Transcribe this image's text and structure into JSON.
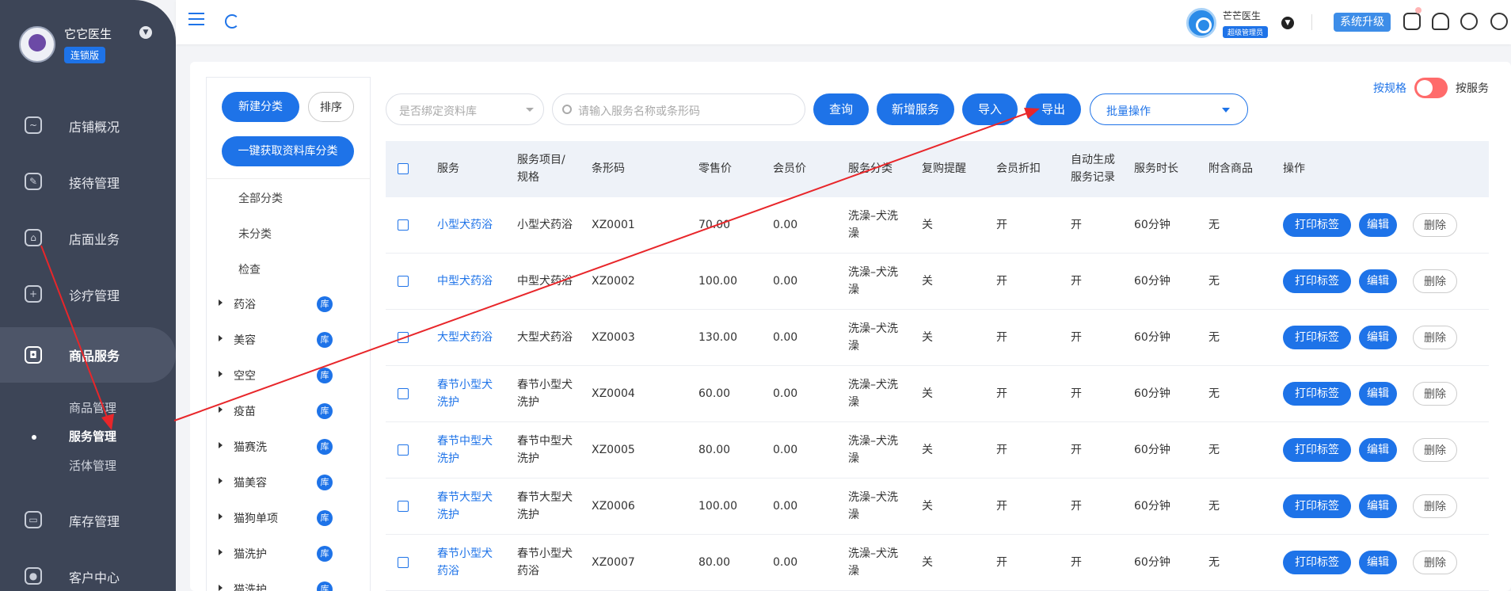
{
  "sidebar": {
    "user_name": "它它医生",
    "badge": "连锁版",
    "nav": [
      {
        "label": "店铺概况"
      },
      {
        "label": "接待管理"
      },
      {
        "label": "店面业务"
      },
      {
        "label": "诊疗管理"
      },
      {
        "label": "商品服务"
      },
      {
        "label": "库存管理"
      },
      {
        "label": "客户中心"
      }
    ],
    "sub_items": [
      {
        "label": "商品管理"
      },
      {
        "label": "服务管理"
      },
      {
        "label": "活体管理"
      }
    ]
  },
  "topbar": {
    "user_name": "芒芒医生",
    "role": "超级管理员",
    "upgrade_label": "系统升级"
  },
  "categories": {
    "new_btn": "新建分类",
    "sort_btn": "排序",
    "fetch_btn": "一键获取资料库分类",
    "static_items": [
      "全部分类",
      "未分类",
      "检查"
    ],
    "tree": [
      {
        "label": "药浴",
        "tag": "库"
      },
      {
        "label": "美容",
        "tag": "库"
      },
      {
        "label": "空空",
        "tag": "库"
      },
      {
        "label": "疫苗",
        "tag": "库"
      },
      {
        "label": "猫赛洗",
        "tag": "库"
      },
      {
        "label": "猫美容",
        "tag": "库"
      },
      {
        "label": "猫狗单项",
        "tag": "库"
      },
      {
        "label": "猫洗护",
        "tag": "库"
      },
      {
        "label": "猫洗护",
        "tag": "库"
      }
    ]
  },
  "filters": {
    "library_placeholder": "是否绑定资料库",
    "search_placeholder": "请输入服务名称或条形码",
    "query_btn": "查询",
    "add_btn": "新增服务",
    "import_btn": "导入",
    "export_btn": "导出",
    "batch_label": "批量操作",
    "toggle_left": "按规格",
    "toggle_right": "按服务"
  },
  "table": {
    "headers": {
      "service": "服务",
      "spec_1": "服务项目/",
      "spec_2": "规格",
      "barcode": "条形码",
      "retail": "零售价",
      "member": "会员价",
      "category": "服务分类",
      "repurchase": "复购提醒",
      "discount": "会员折扣",
      "auto_1": "自动生成",
      "auto_2": "服务记录",
      "duration": "服务时长",
      "attached": "附含商品",
      "actions": "操作"
    },
    "action_labels": {
      "print": "打印标签",
      "edit": "编辑",
      "delete": "删除"
    },
    "rows": [
      {
        "name_1": "小型犬药浴",
        "name_2": "",
        "spec_1": "小型犬药浴",
        "spec_2": "",
        "barcode": "XZ0001",
        "retail": "70.00",
        "member": "0.00",
        "cat_1": "洗澡–犬洗",
        "cat_2": "澡",
        "repurchase": "关",
        "discount": "开",
        "auto": "开",
        "duration": "60分钟",
        "attached": "无"
      },
      {
        "name_1": "中型犬药浴",
        "name_2": "",
        "spec_1": "中型犬药浴",
        "spec_2": "",
        "barcode": "XZ0002",
        "retail": "100.00",
        "member": "0.00",
        "cat_1": "洗澡–犬洗",
        "cat_2": "澡",
        "repurchase": "关",
        "discount": "开",
        "auto": "开",
        "duration": "60分钟",
        "attached": "无"
      },
      {
        "name_1": "大型犬药浴",
        "name_2": "",
        "spec_1": "大型犬药浴",
        "spec_2": "",
        "barcode": "XZ0003",
        "retail": "130.00",
        "member": "0.00",
        "cat_1": "洗澡–犬洗",
        "cat_2": "澡",
        "repurchase": "关",
        "discount": "开",
        "auto": "开",
        "duration": "60分钟",
        "attached": "无"
      },
      {
        "name_1": "春节小型犬",
        "name_2": "洗护",
        "spec_1": "春节小型犬",
        "spec_2": "洗护",
        "barcode": "XZ0004",
        "retail": "60.00",
        "member": "0.00",
        "cat_1": "洗澡–犬洗",
        "cat_2": "澡",
        "repurchase": "关",
        "discount": "开",
        "auto": "开",
        "duration": "60分钟",
        "attached": "无"
      },
      {
        "name_1": "春节中型犬",
        "name_2": "洗护",
        "spec_1": "春节中型犬",
        "spec_2": "洗护",
        "barcode": "XZ0005",
        "retail": "80.00",
        "member": "0.00",
        "cat_1": "洗澡–犬洗",
        "cat_2": "澡",
        "repurchase": "关",
        "discount": "开",
        "auto": "开",
        "duration": "60分钟",
        "attached": "无"
      },
      {
        "name_1": "春节大型犬",
        "name_2": "洗护",
        "spec_1": "春节大型犬",
        "spec_2": "洗护",
        "barcode": "XZ0006",
        "retail": "100.00",
        "member": "0.00",
        "cat_1": "洗澡–犬洗",
        "cat_2": "澡",
        "repurchase": "关",
        "discount": "开",
        "auto": "开",
        "duration": "60分钟",
        "attached": "无"
      },
      {
        "name_1": "春节小型犬",
        "name_2": "药浴",
        "spec_1": "春节小型犬",
        "spec_2": "药浴",
        "barcode": "XZ0007",
        "retail": "80.00",
        "member": "0.00",
        "cat_1": "洗澡–犬洗",
        "cat_2": "澡",
        "repurchase": "关",
        "discount": "开",
        "auto": "开",
        "duration": "60分钟",
        "attached": "无"
      }
    ]
  },
  "colors": {
    "accent": "#1e73e8",
    "sidebar": "#3d4557",
    "annotation": "#e8262a",
    "toggle": "#ff6b6b"
  }
}
